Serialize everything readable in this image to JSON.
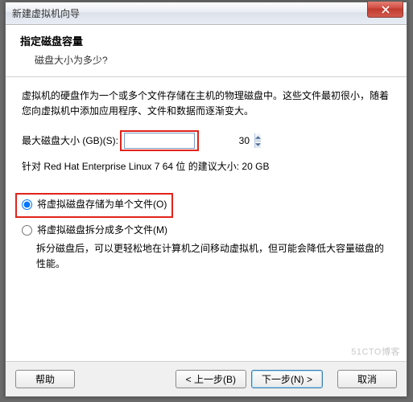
{
  "window": {
    "title": "新建虚拟机向导"
  },
  "header": {
    "title": "指定磁盘容量",
    "subtitle": "磁盘大小为多少?"
  },
  "body": {
    "intro": "虚拟机的硬盘作为一个或多个文件存储在主机的物理磁盘中。这些文件最初很小，随着您向虚拟机中添加应用程序、文件和数据而逐渐变大。",
    "disk_label": "最大磁盘大小 (GB)(S):",
    "disk_value": "30",
    "recommend": "针对 Red Hat Enterprise Linux 7 64 位 的建议大小: 20 GB",
    "radio_single": "将虚拟磁盘存储为单个文件(O)",
    "radio_split": "将虚拟磁盘拆分成多个文件(M)",
    "split_desc": "拆分磁盘后，可以更轻松地在计算机之间移动虚拟机，但可能会降低大容量磁盘的性能。"
  },
  "footer": {
    "help": "帮助",
    "back": "< 上一步(B)",
    "next": "下一步(N) >",
    "cancel": "取消"
  },
  "watermark": "51CTO博客"
}
